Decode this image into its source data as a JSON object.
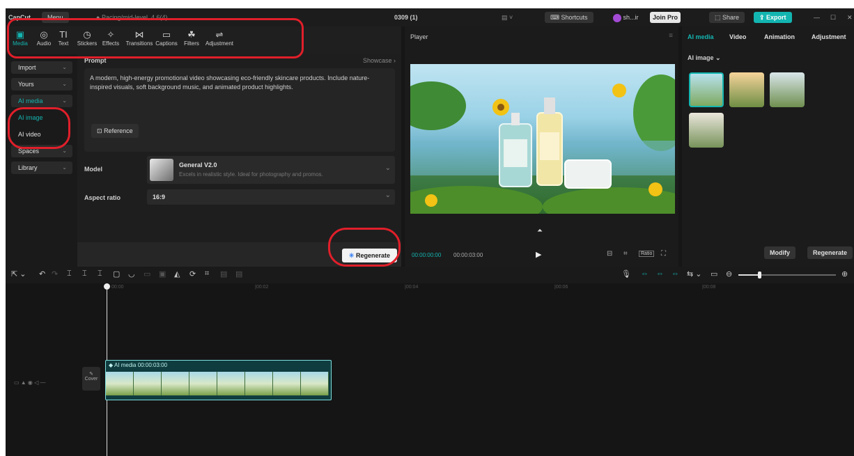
{
  "titlebar": {
    "app_name": "CapCut",
    "menu": "Menu",
    "project_title": "Pacing/mid-level, 4.6(4)",
    "center_title": "0309 (1)",
    "shortcuts": "Shortcuts",
    "user": "sh...ir",
    "join_pro": "Join Pro",
    "share": "Share",
    "export": "Export"
  },
  "toolbar": {
    "items": [
      {
        "label": "Media",
        "icon": "media-icon"
      },
      {
        "label": "Audio",
        "icon": "audio-icon"
      },
      {
        "label": "Text",
        "icon": "text-icon"
      },
      {
        "label": "Stickers",
        "icon": "stickers-icon"
      },
      {
        "label": "Effects",
        "icon": "effects-icon"
      },
      {
        "label": "Transitions",
        "icon": "transitions-icon"
      },
      {
        "label": "Captions",
        "icon": "captions-icon"
      },
      {
        "label": "Filters",
        "icon": "filters-icon"
      },
      {
        "label": "Adjustment",
        "icon": "adjustment-icon"
      }
    ]
  },
  "leftnav": {
    "items": [
      "Import",
      "Yours",
      "AI media",
      "AI image",
      "AI video",
      "Spaces",
      "Library"
    ]
  },
  "center": {
    "prompt_label": "Prompt",
    "showcase": "Showcase",
    "prompt_text": "A modern, high-energy promotional video showcasing eco-friendly skincare products. Include nature-inspired visuals, soft background music, and animated product highlights.",
    "reference": "Reference",
    "model_label": "Model",
    "model_name": "General V2.0",
    "model_desc": "Excels in realistic style. Ideal for photography and promos.",
    "aspect_label": "Aspect ratio",
    "aspect_value": "16:9",
    "regenerate": "Regenerate"
  },
  "player": {
    "title": "Player",
    "time_current": "00:00:00:00",
    "time_total": "00:00:03:00",
    "ratio": "Ratio"
  },
  "right": {
    "tabs": [
      "AI media",
      "Video",
      "Animation",
      "Adjustment"
    ],
    "section": "AI image",
    "modify": "Modify",
    "regenerate": "Regenerate"
  },
  "timeline": {
    "ruler": [
      "00:00",
      "|00:02",
      "|00:04",
      "|00:06",
      "|00:08"
    ],
    "clip_label": "AI media",
    "clip_duration": "00:00:03:00",
    "cover": "Cover"
  },
  "colors": {
    "accent": "#13b5b1",
    "annotation": "#e01f2a"
  }
}
